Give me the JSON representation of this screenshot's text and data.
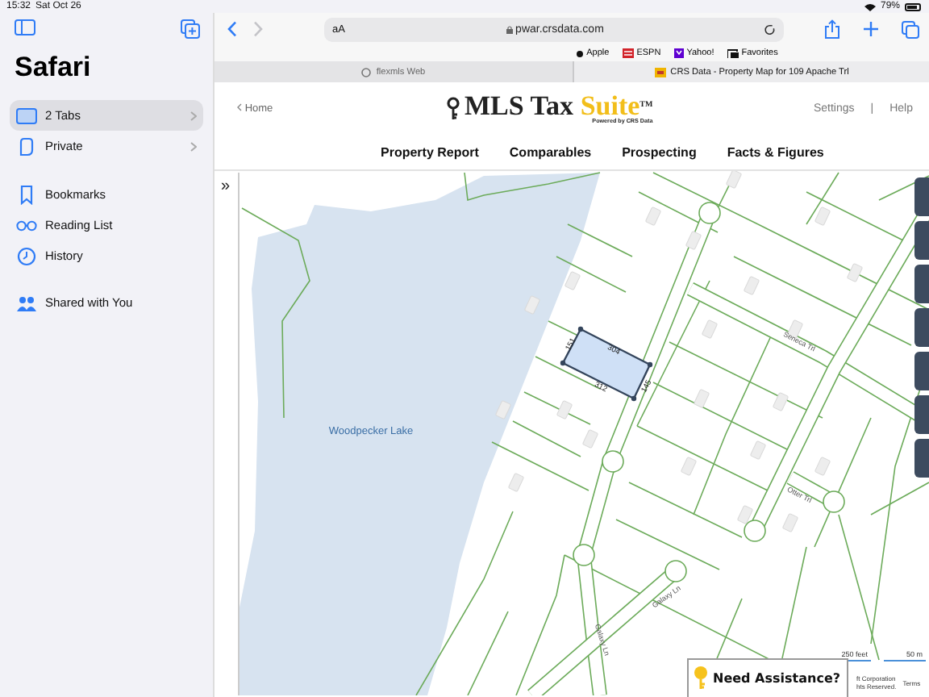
{
  "status_bar": {
    "time": "15:32",
    "date": "Sat Oct 26",
    "battery": "79%"
  },
  "sidebar": {
    "title": "Safari",
    "items": [
      {
        "label": "2 Tabs",
        "kind": "group",
        "selected": true
      },
      {
        "label": "Private",
        "kind": "group",
        "selected": false
      },
      {
        "label": "Bookmarks",
        "kind": "link",
        "selected": false
      },
      {
        "label": "Reading List",
        "kind": "link",
        "selected": false
      },
      {
        "label": "History",
        "kind": "link",
        "selected": false
      },
      {
        "label": "Shared with You",
        "kind": "shared",
        "selected": false
      }
    ]
  },
  "toolbar": {
    "reader_button": "aA",
    "url": "pwar.crsdata.com"
  },
  "favorites": [
    "Apple",
    "ESPN",
    "Yahoo!",
    "Favorites"
  ],
  "tabs": [
    {
      "title": "flexmls Web",
      "selected": false
    },
    {
      "title": "CRS Data - Property Map for 109 Apache Trl",
      "selected": true
    }
  ],
  "page": {
    "home_link": "Home",
    "logo": {
      "brand": "MLS Tax",
      "accent": "Suite",
      "mark": "TM",
      "tagline": "Powered by CRS Data"
    },
    "header_links": [
      "Settings",
      "Help"
    ],
    "separator": "|",
    "nav": [
      "Property Report",
      "Comparables",
      "Prospecting",
      "Facts & Figures"
    ],
    "map": {
      "expand_button": "»",
      "lake_label": "Woodpecker Lake",
      "road_labels": [
        "Seneca Trl",
        "Otter Trl",
        "Galaxy Ln",
        "Galaxy Ln"
      ],
      "parcel_dimensions": [
        "151",
        "304",
        "312",
        "145"
      ],
      "scale": [
        "250 feet",
        "50 m"
      ],
      "attribution": [
        "ft Corporation",
        "hts Reserved.",
        "Terms"
      ],
      "help_button": "Need Assistance?"
    }
  }
}
